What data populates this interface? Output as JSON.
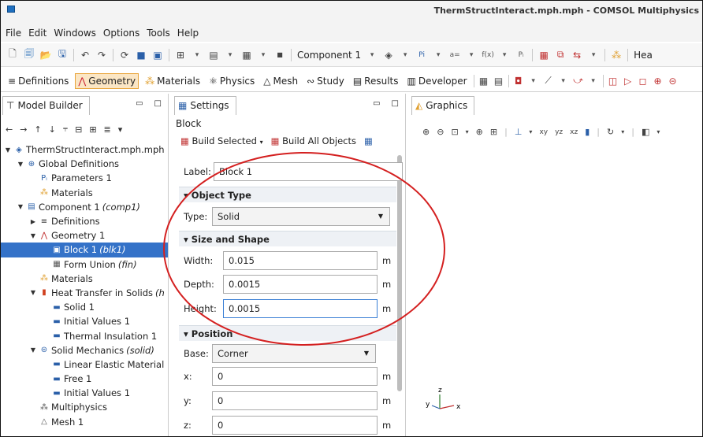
{
  "window": {
    "title": "ThermStructInteract.mph.mph - COMSOL Multiphysics"
  },
  "menu": [
    "File",
    "Edit",
    "Windows",
    "Options",
    "Tools",
    "Help"
  ],
  "toolbar": {
    "component_label": "Component 1",
    "hea_label": "Hea",
    "param_label": "Pi",
    "func_label": "f(x)"
  },
  "ribbon": {
    "tabs": [
      "Definitions",
      "Geometry",
      "Materials",
      "Physics",
      "Mesh",
      "Study",
      "Results",
      "Developer"
    ],
    "active": "Geometry"
  },
  "model_builder": {
    "title": "Model Builder",
    "tree": [
      {
        "label": "ThermStructInteract.mph.mph",
        "level": 0,
        "expanded": true,
        "icon": "model-icon"
      },
      {
        "label": "Global Definitions",
        "level": 1,
        "expanded": true,
        "icon": "globe-icon"
      },
      {
        "label": "Parameters 1",
        "level": 2,
        "icon": "parameters-icon"
      },
      {
        "label": "Materials",
        "level": 2,
        "icon": "materials-icon"
      },
      {
        "label": "Component 1",
        "suffix": "(comp1)",
        "level": 1,
        "expanded": true,
        "icon": "component-icon"
      },
      {
        "label": "Definitions",
        "level": 2,
        "collapsed": true,
        "icon": "definitions-icon"
      },
      {
        "label": "Geometry 1",
        "level": 2,
        "expanded": true,
        "icon": "geometry-icon"
      },
      {
        "label": "Block 1",
        "suffix": "(blk1)",
        "level": 3,
        "selected": true,
        "icon": "block-icon"
      },
      {
        "label": "Form Union",
        "suffix": "(fin)",
        "level": 3,
        "icon": "form-union-icon"
      },
      {
        "label": "Materials",
        "level": 2,
        "icon": "materials-icon"
      },
      {
        "label": "Heat Transfer in Solids",
        "suffix": "(h",
        "level": 2,
        "expanded": true,
        "icon": "heat-transfer-icon"
      },
      {
        "label": "Solid 1",
        "level": 3,
        "icon": "node-icon"
      },
      {
        "label": "Initial Values 1",
        "level": 3,
        "icon": "node-icon"
      },
      {
        "label": "Thermal Insulation 1",
        "level": 3,
        "icon": "node-icon"
      },
      {
        "label": "Solid Mechanics",
        "suffix": "(solid)",
        "level": 2,
        "expanded": true,
        "icon": "solid-mechanics-icon"
      },
      {
        "label": "Linear Elastic Material",
        "level": 3,
        "icon": "node-icon"
      },
      {
        "label": "Free 1",
        "level": 3,
        "icon": "node-icon"
      },
      {
        "label": "Initial Values 1",
        "level": 3,
        "icon": "node-icon"
      },
      {
        "label": "Multiphysics",
        "level": 2,
        "icon": "multiphysics-icon"
      },
      {
        "label": "Mesh 1",
        "level": 2,
        "icon": "mesh-icon"
      }
    ]
  },
  "settings": {
    "title": "Settings",
    "subtitle": "Block",
    "build_selected": "Build Selected",
    "build_all": "Build All Objects",
    "label_caption": "Label:",
    "label_value": "Block 1",
    "sections": {
      "object_type": "Object Type",
      "size_shape": "Size and Shape",
      "position": "Position"
    },
    "type_caption": "Type:",
    "type_value": "Solid",
    "width_caption": "Width:",
    "width_value": "0.015",
    "depth_caption": "Depth:",
    "depth_value": "0.0015",
    "height_caption": "Height:",
    "height_value": "0.0015",
    "unit": "m",
    "base_caption": "Base:",
    "base_value": "Corner",
    "x_caption": "x:",
    "x_value": "0",
    "y_caption": "y:",
    "y_value": "0",
    "z_caption": "z:",
    "z_value": "0"
  },
  "graphics": {
    "title": "Graphics",
    "axis_x": "x",
    "axis_y": "y",
    "axis_z": "z"
  },
  "colors": {
    "selection": "#3472c8",
    "active_tab": "#fbe6c4",
    "annotation": "#d42020"
  }
}
